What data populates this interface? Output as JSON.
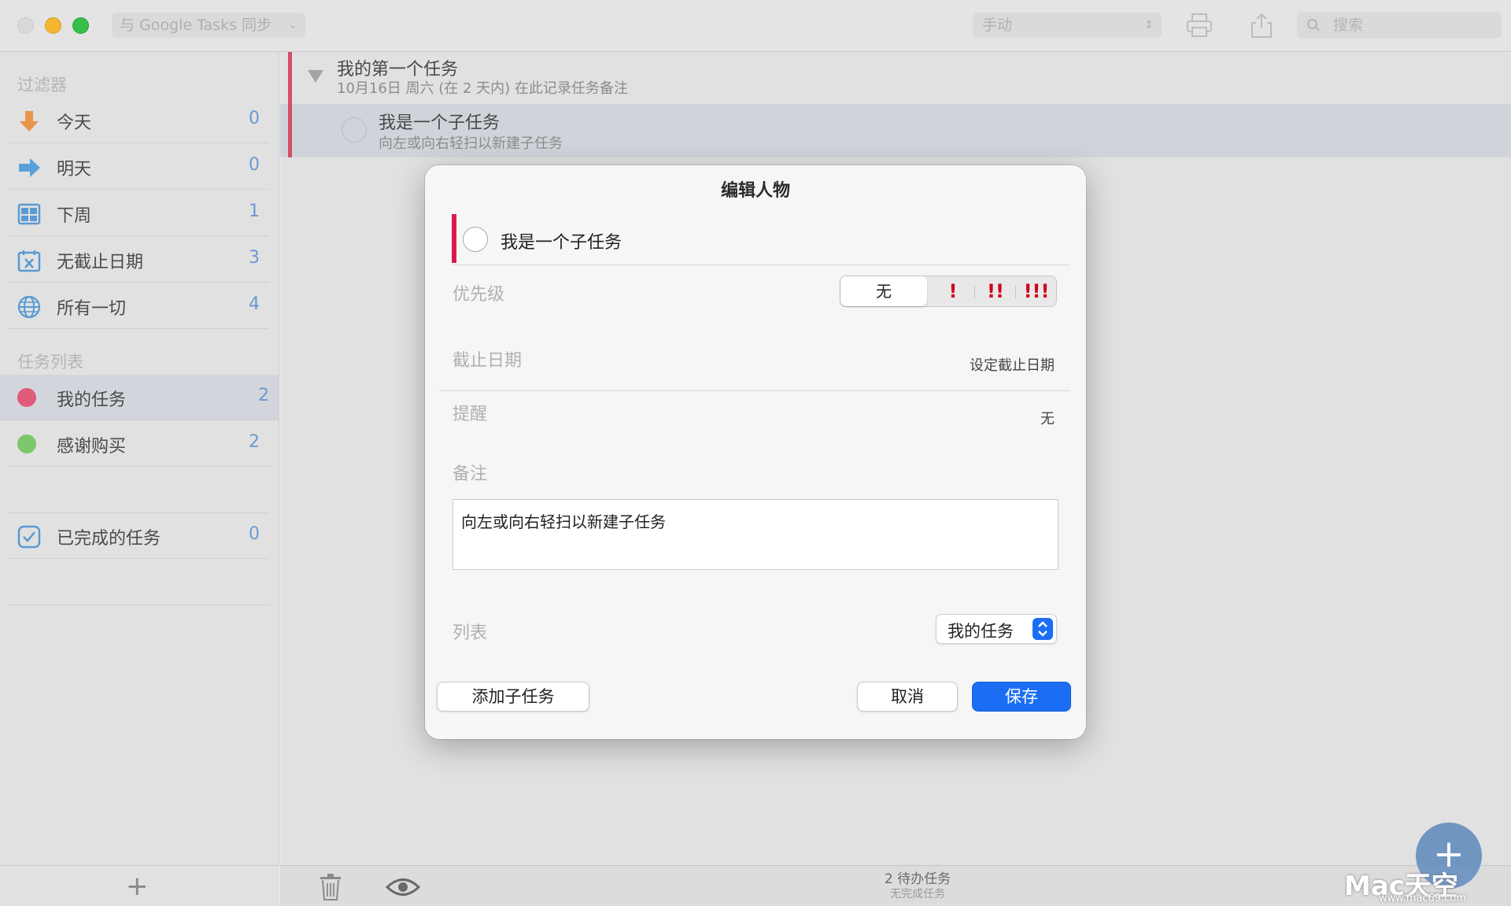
{
  "titlebar": {
    "sync_label": "与 Google Tasks 同步",
    "sort_value": "手动",
    "search_placeholder": "搜索"
  },
  "sidebar": {
    "filters_heading": "过滤器",
    "filters": [
      {
        "label": "今天",
        "count": "0",
        "icon": "arrow-down-icon"
      },
      {
        "label": "明天",
        "count": "0",
        "icon": "arrow-right-icon"
      },
      {
        "label": "下周",
        "count": "1",
        "icon": "calendar-grid-icon"
      },
      {
        "label": "无截止日期",
        "count": "3",
        "icon": "calendar-x-icon"
      },
      {
        "label": "所有一切",
        "count": "4",
        "icon": "globe-icon"
      }
    ],
    "lists_heading": "任务列表",
    "lists": [
      {
        "label": "我的任务",
        "count": "2",
        "color": "#e05a7a"
      },
      {
        "label": "感谢购买",
        "count": "2",
        "color": "#7bc86c"
      }
    ],
    "completed": {
      "label": "已完成的任务",
      "count": "0"
    },
    "add_label": "+"
  },
  "tasks": [
    {
      "title": "我的第一个任务",
      "subtitle": "10月16日 周六 (在 2 天内)   在此记录任务备注"
    },
    {
      "title": "我是一个子任务",
      "subtitle": "向左或向右轻扫以新建子任务"
    }
  ],
  "footer": {
    "status_main": "2 待办任务",
    "status_sub": "无完成任务"
  },
  "fab_label": "+",
  "watermark": {
    "text": "Mac天空",
    "sub": "www.mac69.com"
  },
  "dialog": {
    "title": "编辑人物",
    "task_name": "我是一个子任务",
    "priority_label": "优先级",
    "priority_options": [
      "无",
      "!",
      "!!",
      "!!!"
    ],
    "priority_selected": "无",
    "due_label": "截止日期",
    "due_value": "设定截止日期",
    "reminder_label": "提醒",
    "reminder_value": "无",
    "notes_label": "备注",
    "notes_value": "向左或向右轻扫以新建子任务",
    "list_label": "列表",
    "list_value": "我的任务",
    "add_subtask_label": "添加子任务",
    "cancel_label": "取消",
    "save_label": "保存"
  },
  "colors": {
    "accent": "#1b6ef3",
    "priority_red": "#d0021b",
    "task_bar": "#d91c4e"
  }
}
